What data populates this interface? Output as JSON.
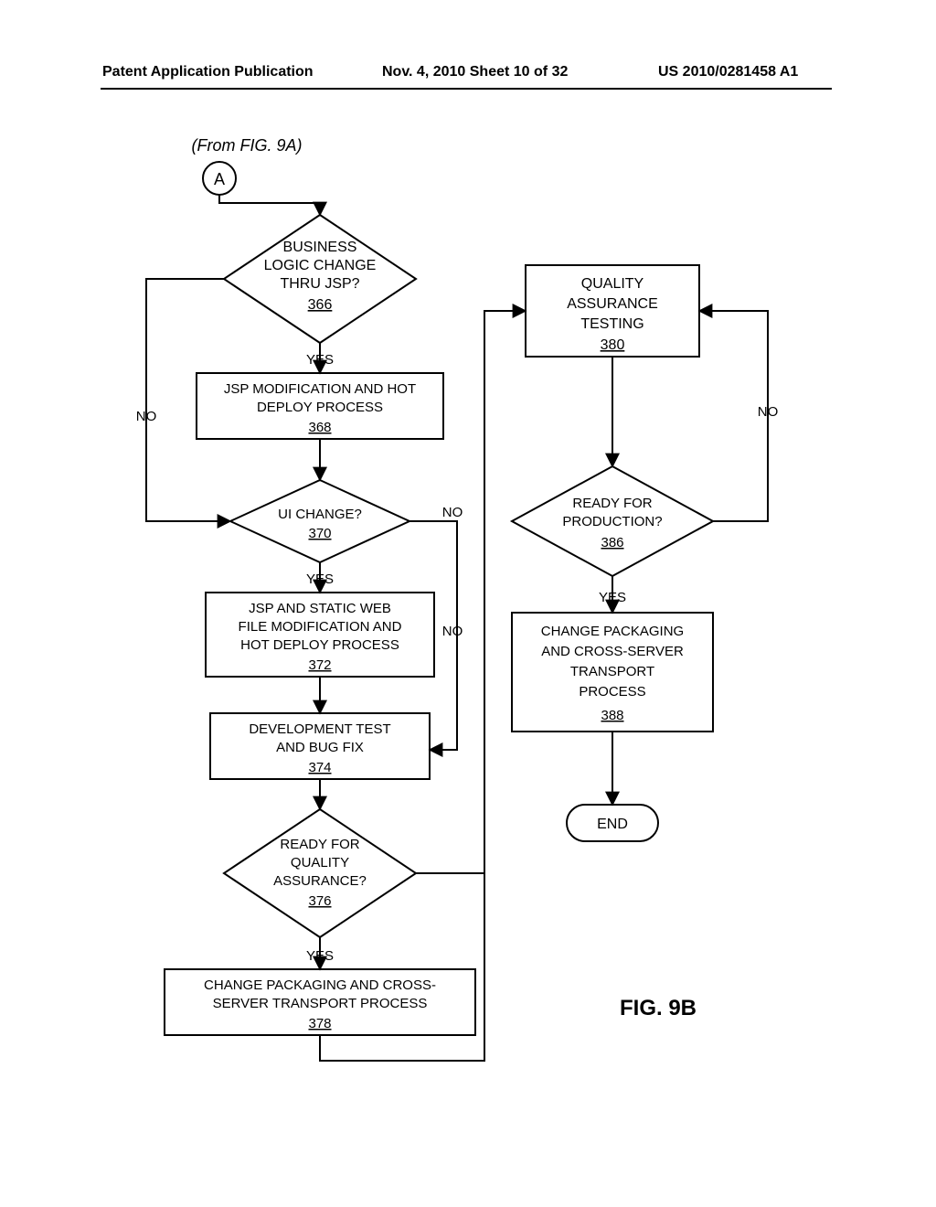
{
  "header": {
    "left": "Patent Application Publication",
    "center": "Nov. 4, 2010  Sheet 10 of 32",
    "right": "US 2010/0281458 A1"
  },
  "figure_label": "FIG. 9B",
  "from_label": "(From FIG. 9A)",
  "connector_a": "A",
  "end_label": "END",
  "yes": "YES",
  "no": "NO",
  "nodes": {
    "n366": {
      "l1": "BUSINESS",
      "l2": "LOGIC CHANGE",
      "l3": "THRU JSP?",
      "ref": "366"
    },
    "n368": {
      "l1": "JSP MODIFICATION AND HOT",
      "l2": "DEPLOY PROCESS",
      "ref": "368"
    },
    "n370": {
      "l1": "UI CHANGE?",
      "ref": "370"
    },
    "n372": {
      "l1": "JSP AND STATIC WEB",
      "l2": "FILE MODIFICATION AND",
      "l3": "HOT DEPLOY PROCESS",
      "ref": "372"
    },
    "n374": {
      "l1": "DEVELOPMENT TEST",
      "l2": "AND BUG FIX",
      "ref": "374"
    },
    "n376": {
      "l1": "READY FOR",
      "l2": "QUALITY",
      "l3": "ASSURANCE?",
      "ref": "376"
    },
    "n378": {
      "l1": "CHANGE PACKAGING AND CROSS-",
      "l2": "SERVER TRANSPORT PROCESS",
      "ref": "378"
    },
    "n380": {
      "l1": "QUALITY",
      "l2": "ASSURANCE",
      "l3": "TESTING",
      "ref": "380"
    },
    "n386": {
      "l1": "READY FOR",
      "l2": "PRODUCTION?",
      "ref": "386"
    },
    "n388": {
      "l1": "CHANGE PACKAGING",
      "l2": "AND CROSS-SERVER",
      "l3": "TRANSPORT",
      "l4": "PROCESS",
      "ref": "388"
    }
  }
}
